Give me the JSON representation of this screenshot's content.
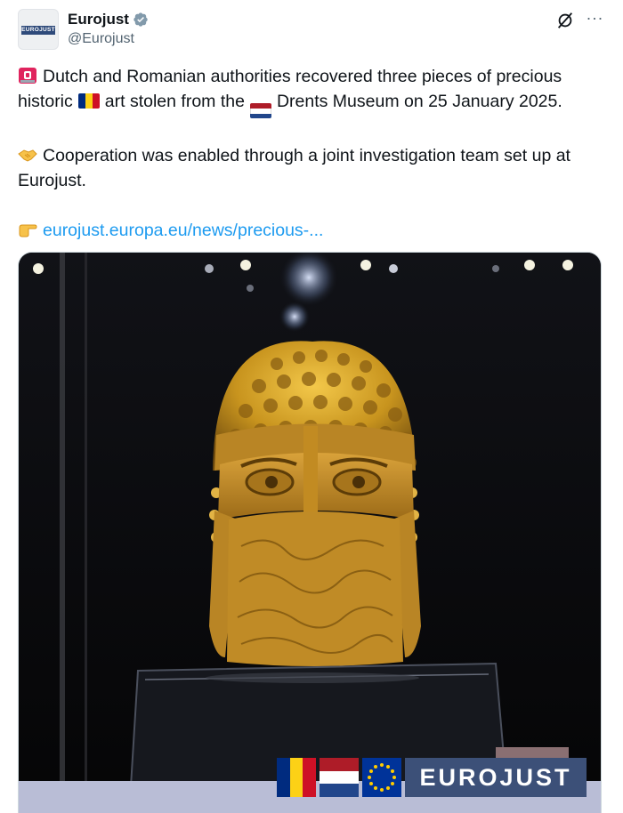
{
  "author": {
    "display_name": "Eurojust",
    "handle": "@Eurojust",
    "avatar_text": "EUROJUST",
    "verified": true
  },
  "actions": {
    "grok_icon": "grok-slash-icon",
    "more_icon": "more-horizontal-icon",
    "more_label": "···"
  },
  "tweet": {
    "p1_part1": "Dutch and Romanian authorities recovered three pieces of precious historic",
    "p1_part2": "art stolen from the",
    "p1_part3": "Drents Museum on 25 January 2025.",
    "p2": "Cooperation was enabled through a joint investigation team set up at Eurojust.",
    "link": "eurojust.europa.eu/news/precious-..."
  },
  "icons": {
    "siren": "police-light-icon",
    "flag_ro": "romania-flag-icon",
    "flag_nl": "netherlands-flag-icon",
    "handshake": "handshake-icon",
    "pointing": "pointing-right-icon"
  },
  "media": {
    "subject": "golden helmet of Cotofenesti",
    "logo_text": "EUROJUST"
  },
  "colors": {
    "link": "#1d9bf0",
    "verified": "#829aab",
    "gold": "#c8941e",
    "brand_navy": "#3c5078",
    "brand_bar": "#b9bdd6"
  }
}
